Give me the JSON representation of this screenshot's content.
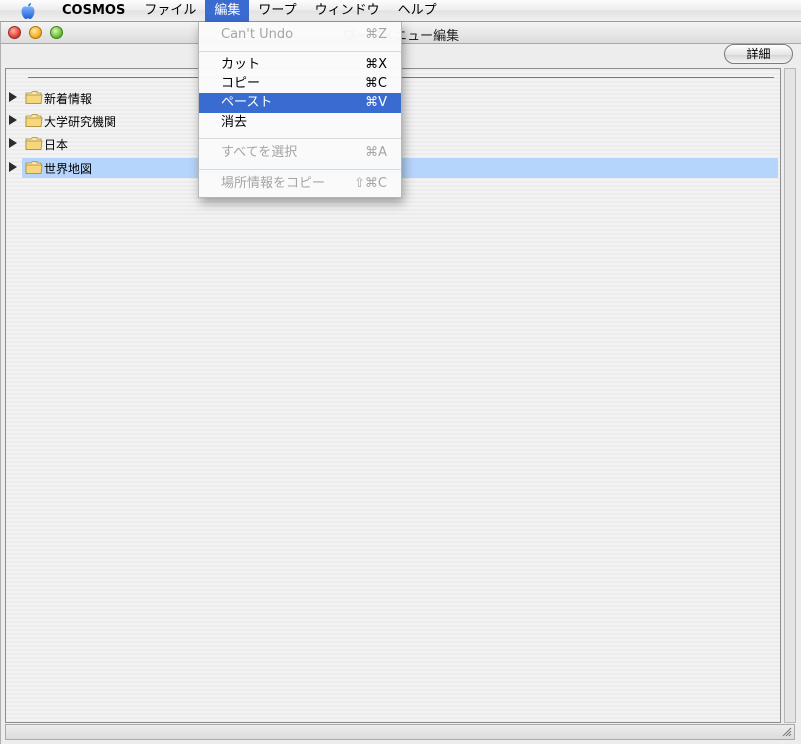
{
  "menubar": {
    "app_name": "COSMOS",
    "menus": [
      "ファイル",
      "編集",
      "ワープ",
      "ウィンドウ",
      "ヘルプ"
    ],
    "active_menu": "編集"
  },
  "window": {
    "title": "ワープメニュー編集",
    "detail_button": "詳細"
  },
  "tree": {
    "items": [
      {
        "label": "新着情報"
      },
      {
        "label": "大学研究機関"
      },
      {
        "label": "日本"
      },
      {
        "label": "世界地図",
        "selected": true
      }
    ]
  },
  "edit_menu": {
    "items": [
      {
        "label": "Can't Undo",
        "shortcut": "⌘Z",
        "disabled": true
      },
      {
        "label": "カット",
        "shortcut": "⌘X"
      },
      {
        "label": "コピー",
        "shortcut": "⌘C"
      },
      {
        "label": "ペースト",
        "shortcut": "⌘V",
        "highlighted": true
      },
      {
        "label": "消去",
        "shortcut": ""
      },
      {
        "label": "すべてを選択",
        "shortcut": "⌘A",
        "disabled": true
      },
      {
        "label": "場所情報をコピー",
        "shortcut": "⇧⌘C",
        "disabled": true
      }
    ]
  },
  "colors": {
    "menu_highlight": "#3a6bd1",
    "selection": "#b6d5fd"
  }
}
